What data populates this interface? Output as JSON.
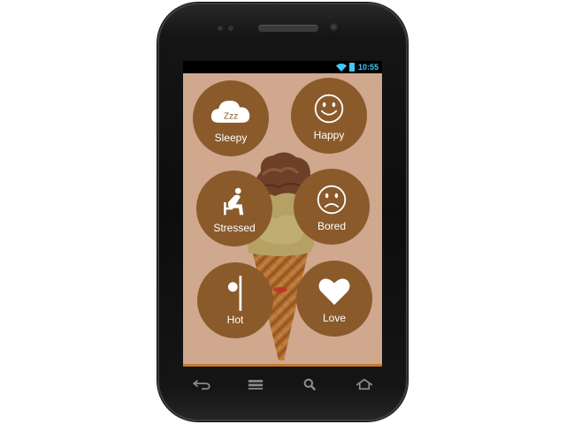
{
  "status_bar": {
    "time": "10:55",
    "icons": [
      "wifi-icon",
      "battery-icon"
    ],
    "accent_color": "#3fc8f4"
  },
  "app": {
    "background_color": "#cfa88e",
    "button_color": "#8b5a2b",
    "background_image": "ice-cream-cone",
    "moods": [
      {
        "label": "Sleepy",
        "icon": "cloud-zzz-icon",
        "zzz": "Zzz"
      },
      {
        "label": "Happy",
        "icon": "smiley-face-icon"
      },
      {
        "label": "Stressed",
        "icon": "stressed-person-icon"
      },
      {
        "label": "Bored",
        "icon": "frown-face-icon"
      },
      {
        "label": "Hot",
        "icon": "thermometer-icon"
      },
      {
        "label": "Love",
        "icon": "heart-icon"
      }
    ]
  },
  "nav_bar": {
    "buttons": [
      "back-icon",
      "menu-icon",
      "search-icon",
      "home-icon"
    ]
  }
}
